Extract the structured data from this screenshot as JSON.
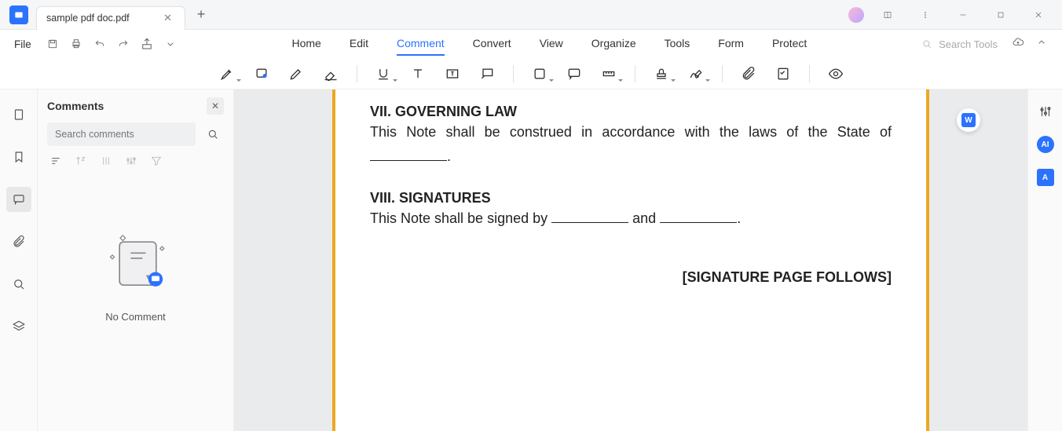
{
  "titlebar": {
    "tab_name": "sample pdf doc.pdf"
  },
  "menubar": {
    "file": "File",
    "items": [
      "Home",
      "Edit",
      "Comment",
      "Convert",
      "View",
      "Organize",
      "Tools",
      "Form",
      "Protect"
    ],
    "active_index": 2,
    "search_placeholder": "Search Tools"
  },
  "comments_panel": {
    "title": "Comments",
    "search_placeholder": "Search comments",
    "empty_text": "No Comment"
  },
  "document": {
    "h7": "VII. GOVERNING LAW",
    "p7a": "This Note shall be construed in accordance with the laws of the State of",
    "p7b": ".",
    "h8": "VIII. SIGNATURES",
    "p8a": "This Note shall be signed by ",
    "p8b": " and ",
    "p8c": ".",
    "sig_follows": "[SIGNATURE PAGE FOLLOWS]"
  },
  "right_badges": {
    "word": "W",
    "ai": "AI",
    "az": "A"
  }
}
